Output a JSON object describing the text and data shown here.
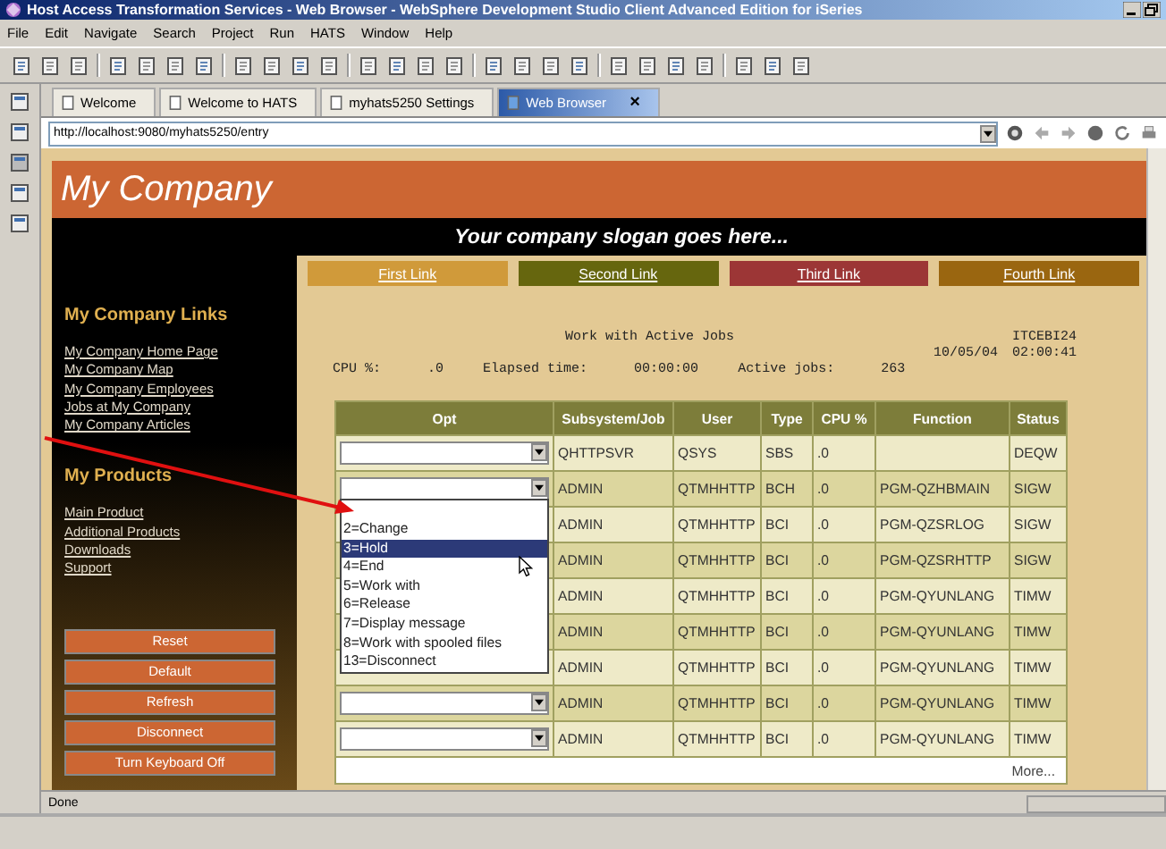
{
  "window": {
    "title": "Host Access Transformation Services - Web Browser - WebSphere Development Studio Client Advanced Edition for iSeries"
  },
  "menu": [
    "File",
    "Edit",
    "Navigate",
    "Search",
    "Project",
    "Run",
    "HATS",
    "Window",
    "Help"
  ],
  "tabs": [
    {
      "label": "Welcome",
      "selected": false
    },
    {
      "label": "Welcome to HATS",
      "selected": false
    },
    {
      "label": "myhats5250 Settings",
      "selected": false
    },
    {
      "label": "Web Browser",
      "selected": true
    }
  ],
  "tab_close": "×",
  "address": {
    "value": "http://localhost:9080/myhats5250/entry"
  },
  "page": {
    "company": "My Company",
    "slogan": "Your company slogan goes here...",
    "top_links": [
      {
        "label": "First Link",
        "color": "#d09a3a"
      },
      {
        "label": "Second Link",
        "color": "#66660e"
      },
      {
        "label": "Third Link",
        "color": "#9c3636"
      },
      {
        "label": "Fourth Link",
        "color": "#9a6610"
      }
    ],
    "sidebar": {
      "sections": [
        {
          "heading": "My Company Links",
          "links": [
            "My Company Home Page",
            "My Company Map",
            "My Company Employees",
            "Jobs at My Company",
            "My Company Articles"
          ]
        },
        {
          "heading": "My Products",
          "links": [
            "Main Product",
            "Additional Products",
            "Downloads",
            "Support"
          ]
        }
      ],
      "buttons": [
        "Reset",
        "Default",
        "Refresh",
        "Disconnect",
        "Turn Keyboard Off"
      ]
    },
    "screen": {
      "title": "Work with Active Jobs",
      "system": "ITCEBI24",
      "date": "10/05/04",
      "time": "02:00:41",
      "stats": [
        {
          "label": "CPU %:",
          "value": ".0"
        },
        {
          "label": "Elapsed time:",
          "value": "00:00:00"
        },
        {
          "label": "Active jobs:",
          "value": "263"
        }
      ]
    },
    "table": {
      "columns": [
        "Opt",
        "Subsystem/Job",
        "User",
        "Type",
        "CPU %",
        "Function",
        "Status"
      ],
      "rows": [
        {
          "job": "QHTTPSVR",
          "user": "QSYS",
          "type": "SBS",
          "cpu": ".0",
          "status": "DEQW"
        },
        {
          "job": "ADMIN",
          "user": "QTMHHTTP",
          "type": "BCH",
          "cpu": ".0",
          "function": "PGM-QZHBMAIN",
          "status": "SIGW"
        },
        {
          "job": "ADMIN",
          "user": "QTMHHTTP",
          "type": "BCI",
          "cpu": ".0",
          "function": "PGM-QZSRLOG",
          "status": "SIGW"
        },
        {
          "job": "ADMIN",
          "user": "QTMHHTTP",
          "type": "BCI",
          "cpu": ".0",
          "function": "PGM-QZSRHTTP",
          "status": "SIGW"
        },
        {
          "job": "ADMIN",
          "user": "QTMHHTTP",
          "type": "BCI",
          "cpu": ".0",
          "function": "PGM-QYUNLANG",
          "status": "TIMW"
        },
        {
          "job": "ADMIN",
          "user": "QTMHHTTP",
          "type": "BCI",
          "cpu": ".0",
          "function": "PGM-QYUNLANG",
          "status": "TIMW"
        },
        {
          "job": "ADMIN",
          "user": "QTMHHTTP",
          "type": "BCI",
          "cpu": ".0",
          "function": "PGM-QYUNLANG",
          "status": "TIMW"
        },
        {
          "job": "ADMIN",
          "user": "QTMHHTTP",
          "type": "BCI",
          "cpu": ".0",
          "function": "PGM-QYUNLANG",
          "status": "TIMW"
        },
        {
          "job": "ADMIN",
          "user": "QTMHHTTP",
          "type": "BCI",
          "cpu": ".0",
          "function": "PGM-QYUNLANG",
          "status": "TIMW"
        }
      ],
      "more": "More..."
    },
    "dropdown": {
      "options": [
        {
          "label": "2=Change",
          "selected": false
        },
        {
          "label": "3=Hold",
          "selected": true
        },
        {
          "label": "4=End",
          "selected": false
        },
        {
          "label": "5=Work with",
          "selected": false
        },
        {
          "label": "6=Release",
          "selected": false
        },
        {
          "label": "7=Display message",
          "selected": false
        },
        {
          "label": "8=Work with spooled files",
          "selected": false
        },
        {
          "label": "13=Disconnect",
          "selected": false
        }
      ]
    }
  },
  "status_bar": "Done"
}
